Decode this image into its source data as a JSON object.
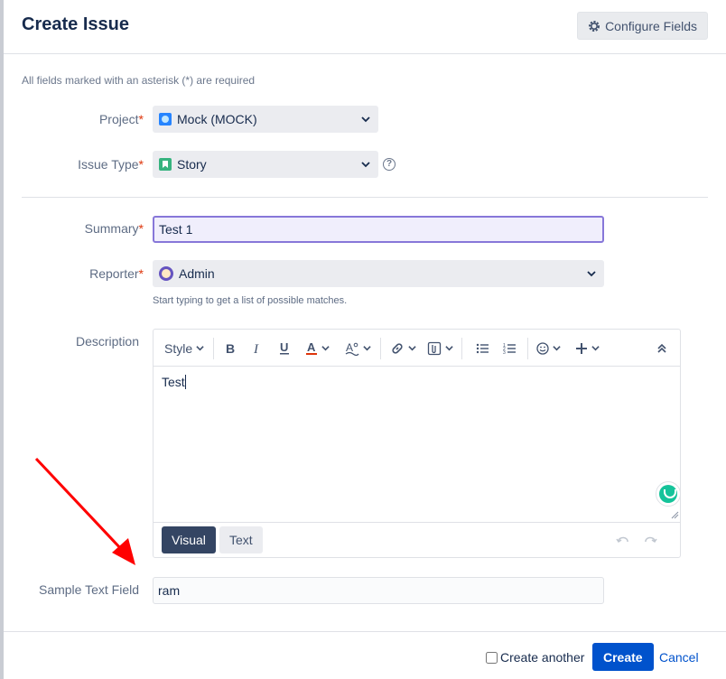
{
  "dialog": {
    "title": "Create Issue",
    "configure_fields_label": "Configure Fields",
    "required_note": "All fields marked with an asterisk (*) are required"
  },
  "fields": {
    "project": {
      "label": "Project",
      "required_mark": "*",
      "value": "Mock (MOCK)",
      "icon": "project-avatar-icon"
    },
    "issue_type": {
      "label": "Issue Type",
      "required_mark": "*",
      "value": "Story",
      "icon": "story-icon"
    },
    "summary": {
      "label": "Summary",
      "required_mark": "*",
      "value": "Test 1"
    },
    "reporter": {
      "label": "Reporter",
      "required_mark": "*",
      "value": "Admin",
      "hint": "Start typing to get a list of possible matches.",
      "icon": "user-avatar-icon"
    },
    "description": {
      "label": "Description",
      "toolbar": {
        "style_label": "Style"
      },
      "content": "Test",
      "modes": {
        "visual": "Visual",
        "text": "Text"
      },
      "active_mode": "Visual"
    },
    "sample_text_field": {
      "label": "Sample Text Field",
      "value": "ram"
    }
  },
  "footer": {
    "create_another_label": "Create another",
    "create_another_checked": false,
    "create_label": "Create",
    "cancel_label": "Cancel"
  },
  "colors": {
    "primary": "#0052cc",
    "required": "#de350b",
    "annotation_arrow": "#ff0000",
    "summary_focus_border": "#8777d9"
  }
}
